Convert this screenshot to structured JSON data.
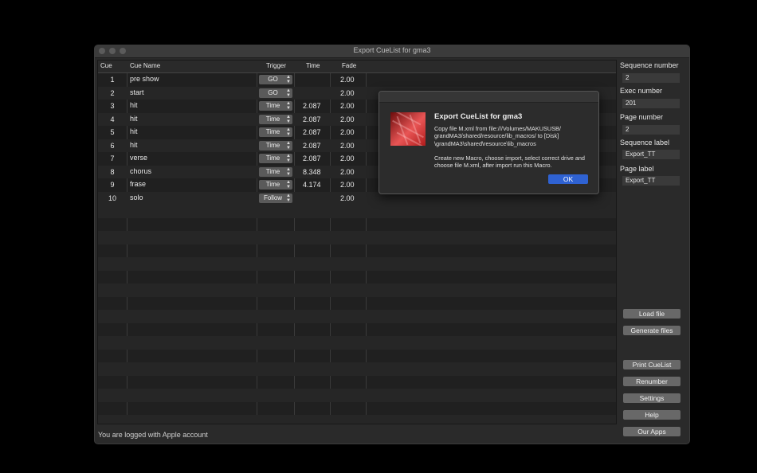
{
  "window": {
    "title": "Export CueList for gma3"
  },
  "table": {
    "headers": {
      "cue": "Cue",
      "name": "Cue Name",
      "trigger": "Trigger",
      "time": "Time",
      "fade": "Fade"
    },
    "rows": [
      {
        "cue": "1",
        "name": "pre show",
        "trigger": "GO",
        "time": "",
        "fade": "2.00"
      },
      {
        "cue": "2",
        "name": "start",
        "trigger": "GO",
        "time": "",
        "fade": "2.00"
      },
      {
        "cue": "3",
        "name": "hit",
        "trigger": "Time",
        "time": "2.087",
        "fade": "2.00"
      },
      {
        "cue": "4",
        "name": "hit",
        "trigger": "Time",
        "time": "2.087",
        "fade": "2.00"
      },
      {
        "cue": "5",
        "name": "hit",
        "trigger": "Time",
        "time": "2.087",
        "fade": "2.00"
      },
      {
        "cue": "6",
        "name": "hit",
        "trigger": "Time",
        "time": "2.087",
        "fade": "2.00"
      },
      {
        "cue": "7",
        "name": "verse",
        "trigger": "Time",
        "time": "2.087",
        "fade": "2.00"
      },
      {
        "cue": "8",
        "name": "chorus",
        "trigger": "Time",
        "time": "8.348",
        "fade": "2.00"
      },
      {
        "cue": "9",
        "name": "frase",
        "trigger": "Time",
        "time": "4.174",
        "fade": "2.00"
      },
      {
        "cue": "10",
        "name": "solo",
        "trigger": "Follow",
        "time": "",
        "fade": "2.00"
      }
    ],
    "empty_rows": 17
  },
  "right_panel": {
    "sequence_number": {
      "label": "Sequence number",
      "value": "2"
    },
    "exec_number": {
      "label": "Exec number",
      "value": "201"
    },
    "page_number": {
      "label": "Page number",
      "value": "2"
    },
    "sequence_label": {
      "label": "Sequence label",
      "value": "Export_TT"
    },
    "page_label": {
      "label": "Page label",
      "value": "Export_TT"
    },
    "buttons": {
      "load_file": "Load file",
      "generate_files": "Generate files",
      "print_cuelist": "Print CueList",
      "renumber": "Renumber",
      "settings": "Settings",
      "help": "Help",
      "our_apps": "Our Apps"
    }
  },
  "status": "You are logged with Apple account",
  "dialog": {
    "title": "Export CueList for gma3",
    "message_line1": "Copy file M.xml from file:///Volumes/MAKUSUSB/ grandMA3/shared/resource/lib_macros/ to [Disk] \\grandMA3\\shared\\resource\\lib_macros",
    "message_line2": "Create new Macro, choose import, select correct drive and choose file M.xml, after import run this Macro.",
    "ok_label": "OK",
    "icon": "app-icon"
  },
  "colors": {
    "accent": "#2f62d2",
    "background": "#000000",
    "window": "#2a2a2a"
  }
}
